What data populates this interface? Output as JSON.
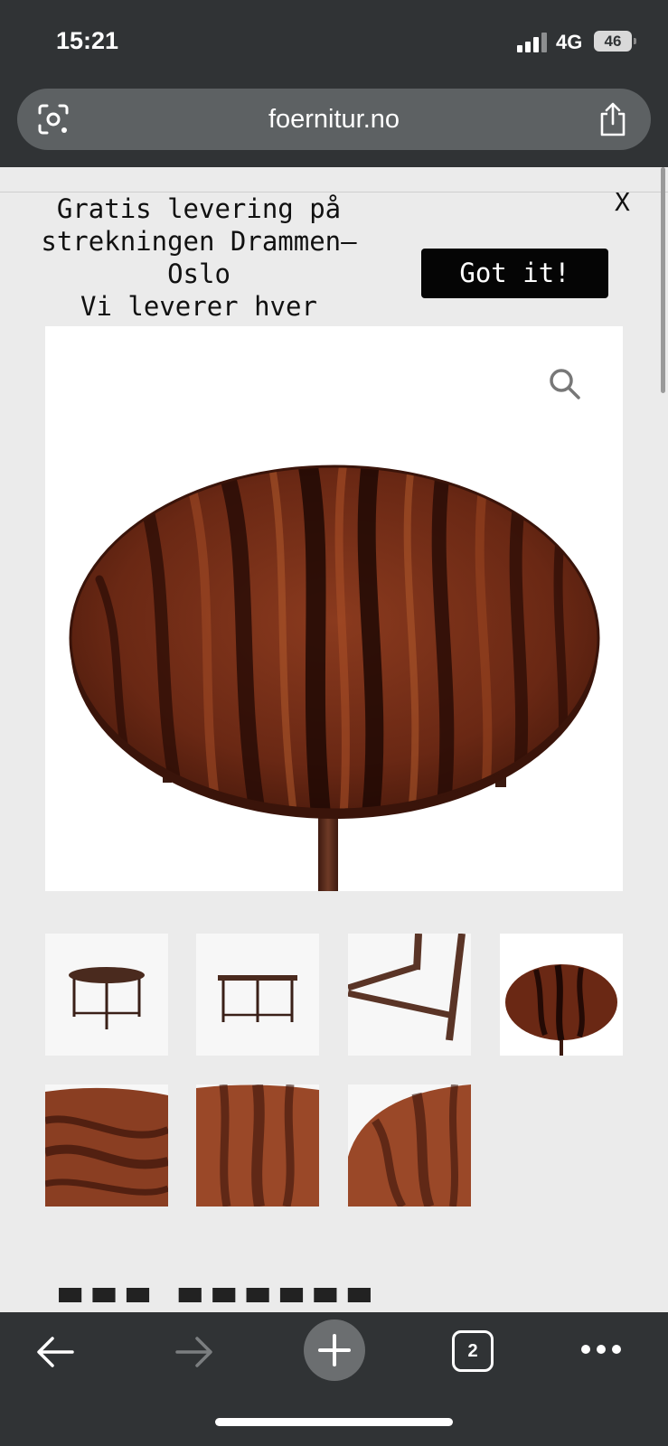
{
  "status_bar": {
    "time": "15:21",
    "network": "4G",
    "battery": "46"
  },
  "browser": {
    "url": "foernitur.no",
    "tab_count": "2"
  },
  "banner": {
    "title": "Gratis levering på strekningen Drammen—Oslo",
    "subtitle": "Vi leverer hver onsdag.",
    "button_label": "Got it!",
    "close_label": "X"
  },
  "product": {
    "thumbnails": [
      "table-side-view-1",
      "table-side-view-2",
      "table-leg-detail",
      "table-top-view",
      "wood-grain-detail-1",
      "wood-grain-detail-2",
      "wood-grain-detail-3"
    ]
  },
  "colors": {
    "chrome": "#303335",
    "pill": "#5d6163",
    "wood": "#6a2a18"
  }
}
